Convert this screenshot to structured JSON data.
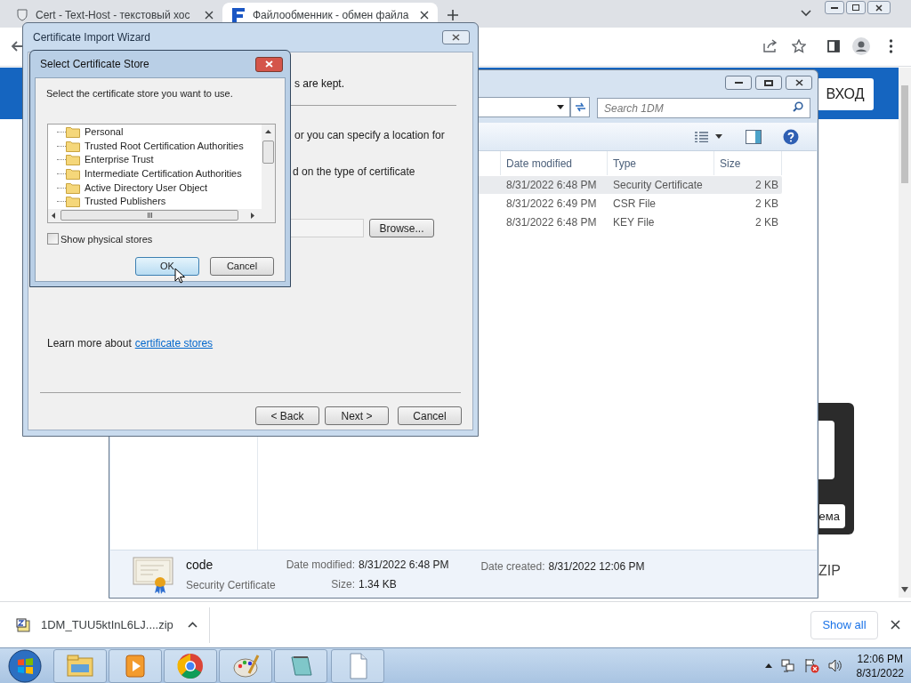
{
  "browser": {
    "tabs": [
      {
        "title": "Cert - Text-Host - текстовый хос",
        "selected": false
      },
      {
        "title": "Файлообменник - обмен файла",
        "selected": true
      }
    ],
    "page": {
      "login_button": "ВХОД",
      "partial_button": "ема",
      "partial_label": "ZIP"
    }
  },
  "explorer": {
    "search": {
      "placeholder": "Search 1DM"
    },
    "columns": [
      "Date modified",
      "Type",
      "Size"
    ],
    "rows": [
      {
        "date": "8/31/2022 6:48 PM",
        "type": "Security Certificate",
        "size": "2 KB",
        "selected": true
      },
      {
        "date": "8/31/2022 6:49 PM",
        "type": "CSR File",
        "size": "2 KB",
        "selected": false
      },
      {
        "date": "8/31/2022 6:48 PM",
        "type": "KEY File",
        "size": "2 KB",
        "selected": false
      }
    ],
    "details": {
      "name": "code",
      "type": "Security Certificate",
      "modified_label": "Date modified:",
      "modified": "8/31/2022 6:48 PM",
      "size_label": "Size:",
      "size": "1.34 KB",
      "created_label": "Date created:",
      "created": "8/31/2022 12:06 PM"
    }
  },
  "wizard": {
    "title": "Certificate Import Wizard",
    "texts": [
      "s are kept.",
      "or you can specify a location for",
      "d on the type of certificate"
    ],
    "browse": "Browse...",
    "learn_more": {
      "text": "Learn more about",
      "link": "certificate stores"
    },
    "buttons": [
      "< Back",
      "Next >",
      "Cancel"
    ]
  },
  "store_dialog": {
    "title": "Select Certificate Store",
    "prompt": "Select the certificate store you want to use.",
    "stores": [
      "Personal",
      "Trusted Root Certification Authorities",
      "Enterprise Trust",
      "Intermediate Certification Authorities",
      "Active Directory User Object",
      "Trusted Publishers"
    ],
    "show_physical": {
      "label": "Show physical stores",
      "checked": false
    },
    "buttons": [
      "OK",
      "Cancel"
    ]
  },
  "downloads": {
    "file": "1DM_TUU5ktInL6LJ....zip",
    "show_all": "Show all"
  },
  "taskbar": {
    "time": "12:06 PM",
    "date": "8/31/2022"
  }
}
